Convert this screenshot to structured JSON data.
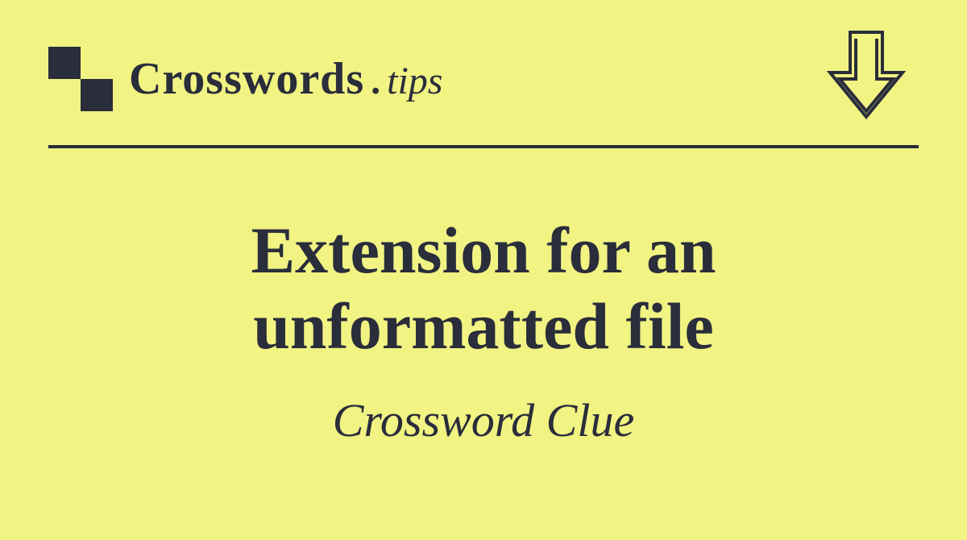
{
  "logo": {
    "main": "Crosswords",
    "dot": ".",
    "tips": "tips"
  },
  "clue": {
    "title": "Extension for an unformatted file",
    "subtitle": "Crossword Clue"
  }
}
